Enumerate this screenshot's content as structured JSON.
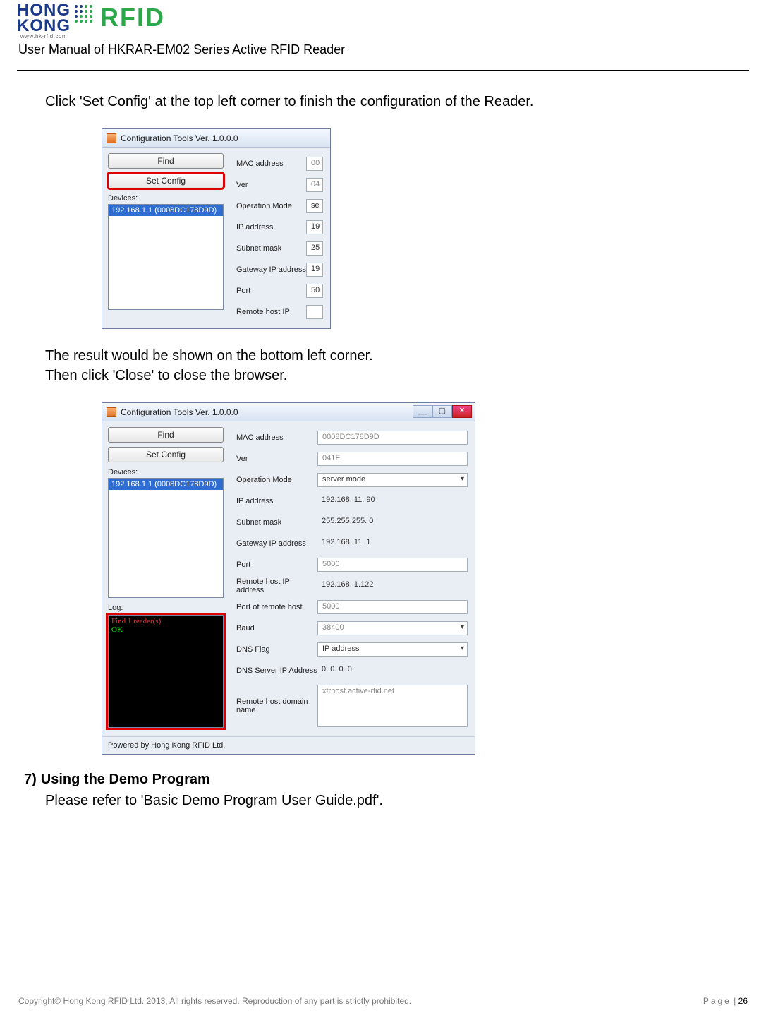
{
  "logo": {
    "hk1": "HONG",
    "hk2": "KONG",
    "rfid": "RFID",
    "url": "www.hk-rfid.com"
  },
  "manual_title": "User Manual of HKRAR-EM02 Series Active RFID Reader",
  "para1": "Click 'Set Config' at the top left corner to finish the configuration of the Reader.",
  "para2a": "The result would be shown on the bottom left corner.",
  "para2b": "Then click 'Close' to close the browser.",
  "section7": {
    "num": "7)",
    "title": "Using the Demo Program",
    "text": "Please refer to 'Basic Demo Program User Guide.pdf'."
  },
  "shot1": {
    "win_title": "Configuration Tools Ver. 1.0.0.0",
    "btn_find": "Find",
    "btn_set": "Set Config",
    "devices_label": "Devices:",
    "selected_device": "192.168.1.1 (0008DC178D9D)",
    "rows": [
      {
        "label": "MAC address",
        "val": "00"
      },
      {
        "label": "Ver",
        "val": "04"
      },
      {
        "label": "Operation Mode",
        "val": "se"
      },
      {
        "label": "IP address",
        "val": "19"
      },
      {
        "label": "Subnet mask",
        "val": "25"
      },
      {
        "label": "Gateway IP address",
        "val": "19"
      },
      {
        "label": "Port",
        "val": "50"
      },
      {
        "label": "Remote host IP",
        "val": ""
      }
    ]
  },
  "shot2": {
    "win_title": "Configuration Tools Ver. 1.0.0.0",
    "btn_find": "Find",
    "btn_set": "Set Config",
    "devices_label": "Devices:",
    "selected_device": "192.168.1.1 (0008DC178D9D)",
    "log_label": "Log:",
    "log_line1": "Find 1 reader(s)",
    "log_line2": "OK",
    "footer_line": "Powered by Hong Kong RFID Ltd.",
    "rows": {
      "mac": {
        "label": "MAC address",
        "val": "0008DC178D9D"
      },
      "ver": {
        "label": "Ver",
        "val": "041F"
      },
      "opmode": {
        "label": "Operation Mode",
        "val": "server mode"
      },
      "ip": {
        "label": "IP address",
        "val": "192.168. 11. 90"
      },
      "subnet": {
        "label": "Subnet mask",
        "val": "255.255.255.  0"
      },
      "gateway": {
        "label": "Gateway IP address",
        "val": "192.168. 11.  1"
      },
      "port": {
        "label": "Port",
        "val": "5000"
      },
      "rhostip": {
        "label": "Remote host IP address",
        "val": "192.168.  1.122"
      },
      "rhostport": {
        "label": "Port of remote host",
        "val": "5000"
      },
      "baud": {
        "label": "Baud",
        "val": "38400"
      },
      "dnsflag": {
        "label": "DNS Flag",
        "val": "IP address"
      },
      "dnsip": {
        "label": "DNS Server IP Address",
        "val": " 0.  0.  0.  0"
      },
      "rhostdom": {
        "label": "Remote host domain name",
        "val": "xtrhost.active-rfid.net"
      }
    }
  },
  "footer": {
    "copyright": "Copyright© Hong Kong RFID Ltd. 2013, All rights reserved. Reproduction of any part is strictly prohibited.",
    "page_label": "Page",
    "page_sep": " | ",
    "page_num": "26"
  }
}
